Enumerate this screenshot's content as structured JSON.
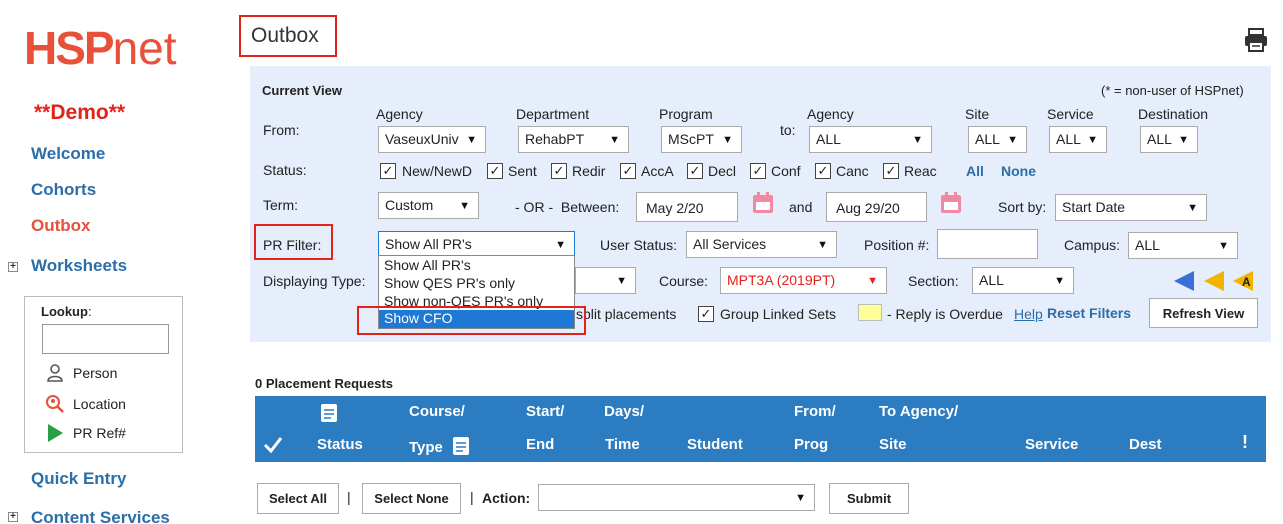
{
  "sidebar": {
    "logo_main": "HSP",
    "logo_net": "net",
    "demo": "**Demo**",
    "welcome": "Welcome",
    "cohorts": "Cohorts",
    "outbox": "Outbox",
    "worksheets": "Worksheets",
    "quick_entry": "Quick Entry",
    "content_services": "Content Services",
    "lookup": {
      "title": "Lookup",
      "colon": ":",
      "person": "Person",
      "location": "Location",
      "pr_ref": "PR Ref#"
    }
  },
  "page_title": "Outbox",
  "panel": {
    "current_view": "Current View",
    "non_user_note": "(* = non-user of HSPnet)",
    "from_label": "From:",
    "to_label": "to:",
    "headers": {
      "agency": "Agency",
      "department": "Department",
      "program": "Program",
      "to_agency": "Agency",
      "site": "Site",
      "service": "Service",
      "destination": "Destination"
    },
    "from_agency": "VaseuxUniv",
    "from_department": "RehabPT",
    "from_program": "MScPT",
    "to_agency_value": "ALL",
    "site_value": "ALL",
    "service_value": "ALL",
    "destination_value": "ALL",
    "status_label": "Status:",
    "statuses": [
      "New/NewD",
      "Sent",
      "Redir",
      "AccA",
      "Decl",
      "Conf",
      "Canc",
      "Reac"
    ],
    "all_link": "All",
    "none_link": "None",
    "term_label": "Term:",
    "term_value": "Custom",
    "or_between": "- OR -  Between:",
    "date_from": "May 2/20",
    "and": "and",
    "date_to": "Aug 29/20",
    "sort_by_label": "Sort by:",
    "sort_by_value": "Start Date",
    "pr_filter_label": "PR Filter:",
    "pr_filter_value": "Show All PR's",
    "user_status_label": "User Status:",
    "user_status_value": "All Services",
    "position_label": "Position #:",
    "campus_label": "Campus:",
    "campus_value": "ALL",
    "displaying_type_label": "Displaying Type:",
    "course_label": "Course:",
    "course_value": "MPT3A (2019PT)",
    "section_label": "Section:",
    "section_value": "ALL",
    "split_placements": "split placements",
    "group_linked_sets": "Group Linked Sets",
    "reply_overdue": "- Reply is Overdue",
    "help": "Help",
    "reset_filters": "Reset Filters",
    "refresh_view": "Refresh View",
    "dropdown_options": [
      "Show All PR's",
      "Show QES PR's only",
      "Show non-QES PR's only",
      "Show CFO"
    ]
  },
  "table": {
    "count_label": "0 Placement Requests",
    "headers": {
      "status": "Status",
      "course_top": "Course/",
      "type": "Type",
      "start_top": "Start/",
      "end": "End",
      "days_top": "Days/",
      "time": "Time",
      "student": "Student",
      "from_top": "From/",
      "prog": "Prog",
      "to_agency_top": "To Agency/",
      "site": "Site",
      "service": "Service",
      "dest": "Dest",
      "alert": "!"
    }
  },
  "footer": {
    "select_all": "Select All",
    "select_none": "Select None",
    "sep": "|",
    "action_label": "Action:",
    "submit": "Submit"
  },
  "colors": {
    "brand": "#e8503a",
    "link": "#2b6ea8",
    "panel_bg": "#e6edfb",
    "table_header": "#2b7cc0",
    "highlight": "#1e78d6",
    "annotation_red": "#e2231a"
  }
}
